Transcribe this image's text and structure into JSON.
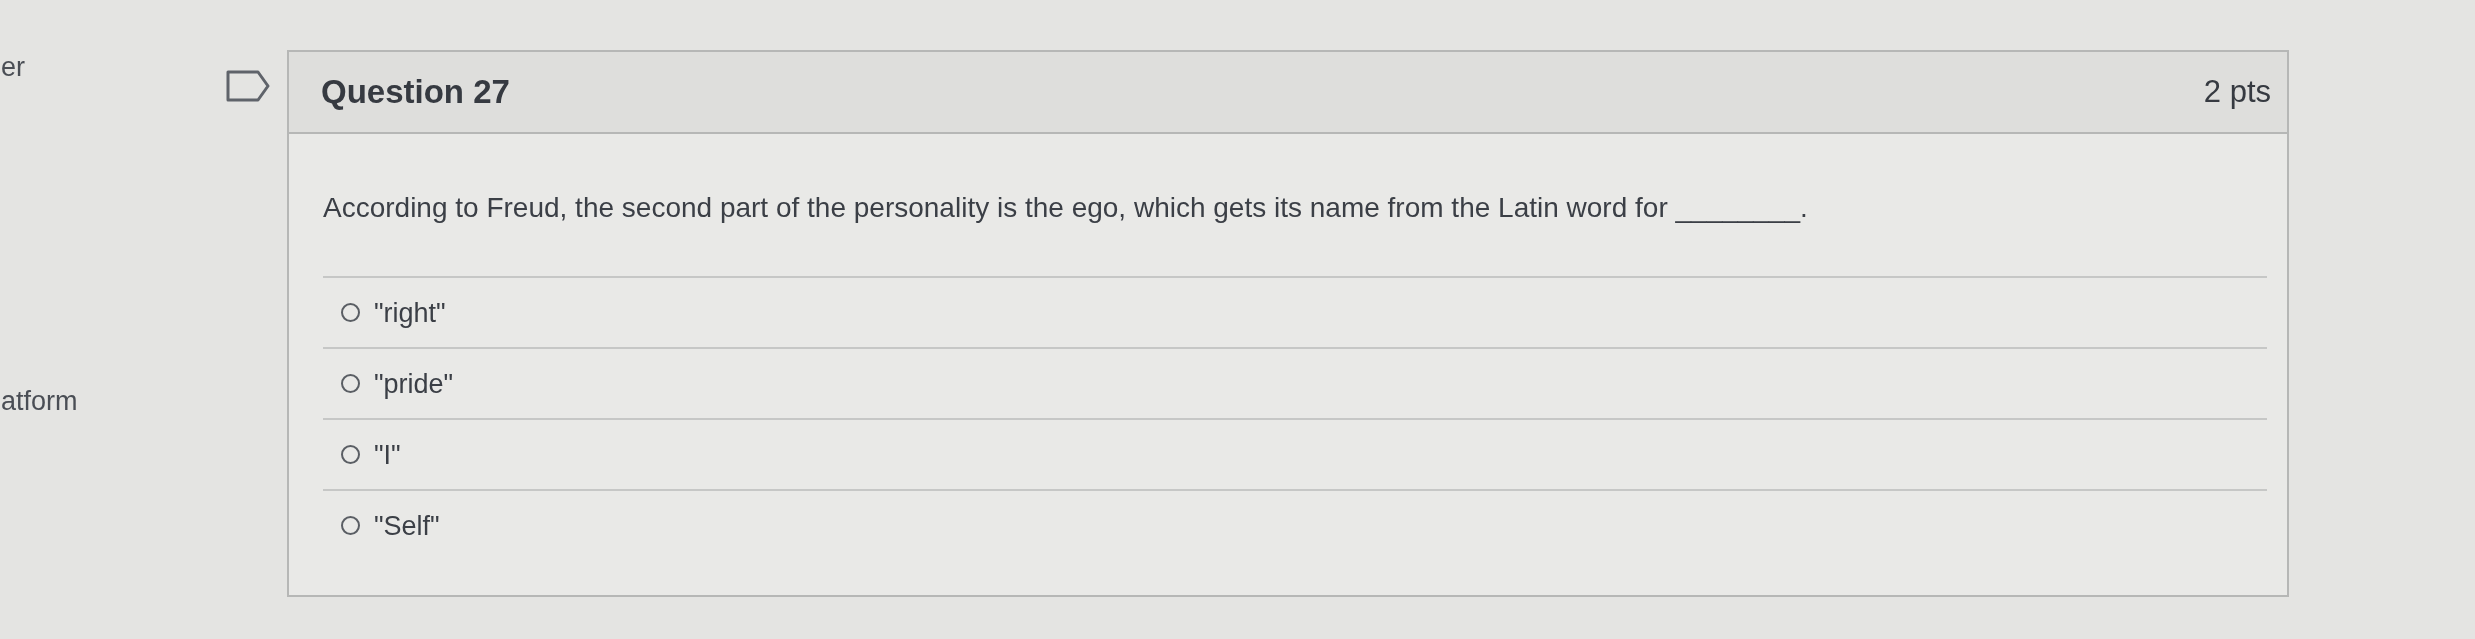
{
  "sidebar": {
    "items": [
      "er",
      "atform"
    ]
  },
  "question": {
    "flagged": false,
    "title": "Question 27",
    "points": "2 pts",
    "text": "According to Freud, the second part of the personality is the ego, which gets its name from the Latin word for ________.",
    "answers": [
      {
        "label": "\"right\"",
        "selected": false
      },
      {
        "label": "\"pride\"",
        "selected": false
      },
      {
        "label": "\"I\"",
        "selected": false
      },
      {
        "label": "\"Self\"",
        "selected": false
      }
    ]
  }
}
